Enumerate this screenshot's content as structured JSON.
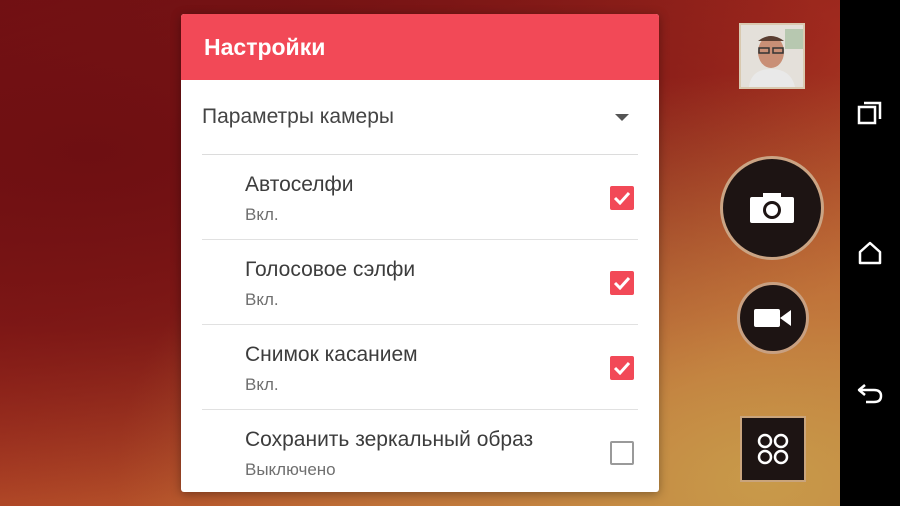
{
  "dialog": {
    "title": "Настройки",
    "section": "Параметры камеры",
    "items": [
      {
        "title": "Автоселфи",
        "subtitle": "Вкл.",
        "checked": true
      },
      {
        "title": "Голосовое сэлфи",
        "subtitle": "Вкл.",
        "checked": true
      },
      {
        "title": "Снимок касанием",
        "subtitle": "Вкл.",
        "checked": true
      },
      {
        "title": "Сохранить зеркальный образ",
        "subtitle": "Выключено",
        "checked": false
      }
    ]
  },
  "camera": {
    "icons": [
      "photo-thumbnail",
      "camera-icon",
      "video-camera-icon",
      "modes-grid-icon"
    ]
  },
  "navbar": {
    "icons": [
      "recent-apps-icon",
      "home-icon",
      "back-icon"
    ]
  },
  "colors": {
    "accent": "#f24957",
    "control_bg": "#1d1413",
    "navbar": "#000000"
  }
}
